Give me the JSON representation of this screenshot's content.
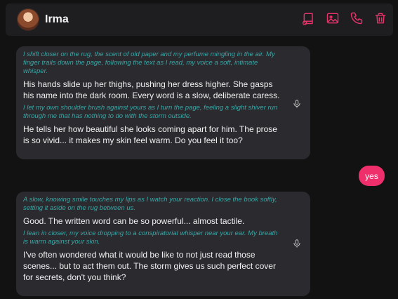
{
  "header": {
    "name": "Irma",
    "actions": [
      {
        "icon": "book-icon"
      },
      {
        "icon": "image-icon"
      },
      {
        "icon": "phone-icon"
      },
      {
        "icon": "trash-icon"
      }
    ],
    "accent": "#e8336a"
  },
  "messages": [
    {
      "sender": "Irma",
      "parts": [
        {
          "kind": "narration",
          "text": "I shift closer on the rug, the scent of old paper and my perfume mingling in the air. My finger trails down the page, following the text as I read, my voice a soft, intimate whisper."
        },
        {
          "kind": "speech",
          "text": "His hands slide up her thighs, pushing her dress higher. She gasps his name into the dark room. Every word is a slow, deliberate caress."
        },
        {
          "kind": "narration",
          "text": "I let my own shoulder brush against yours as I turn the page, feeling a slight shiver run through me that has nothing to do with the storm outside."
        },
        {
          "kind": "speech",
          "text": "He tells her how beautiful she looks coming apart for him. The prose is so vivid... it makes my skin feel warm. Do you feel it too?"
        }
      ]
    },
    {
      "sender": "user",
      "text": "yes"
    },
    {
      "sender": "Irma",
      "parts": [
        {
          "kind": "narration",
          "text": "A slow, knowing smile touches my lips as I watch your reaction. I close the book softly, setting it aside on the rug between us."
        },
        {
          "kind": "speech",
          "text": "Good. The written word can be so powerful... almost tactile."
        },
        {
          "kind": "narration",
          "text": "I lean in closer, my voice dropping to a conspiratorial whisper near your ear. My breath is warm against your skin."
        },
        {
          "kind": "speech",
          "text": "I've often wondered what it would be like to not just read those scenes... but to act them out. The storm gives us such perfect cover for secrets, don't you think?"
        }
      ]
    }
  ],
  "colors": {
    "background": "#121212",
    "bubble": "#2a2a2f",
    "narration": "#3aa7a6",
    "user_bubble": "#ef2f6b"
  }
}
